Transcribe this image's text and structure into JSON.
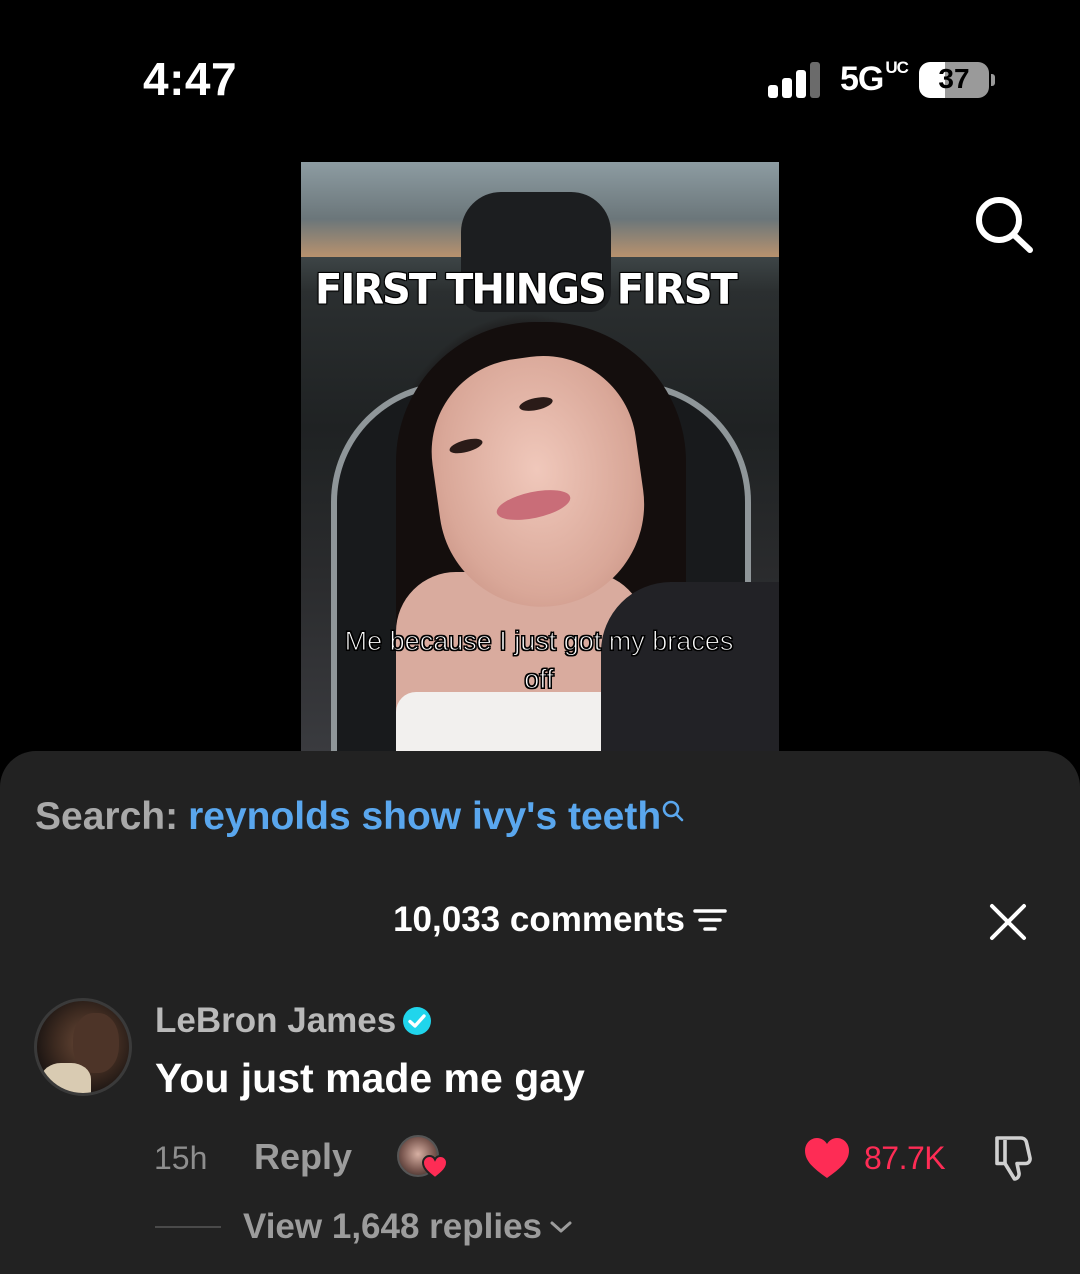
{
  "status_bar": {
    "time": "4:47",
    "network": "5G",
    "network_badge": "UC",
    "battery": "37"
  },
  "video": {
    "caption_top": "FIRST THINGS FIRST",
    "caption_bottom": "Me because I just got my braces off"
  },
  "search": {
    "label": "Search:",
    "term": "reynolds show ivy's teeth"
  },
  "comments": {
    "count_label": "10,033 comments",
    "items": [
      {
        "username": "LeBron James",
        "verified": true,
        "text": "You just made me gay",
        "time": "15h",
        "reply_label": "Reply",
        "likes": "87.7K",
        "view_replies": "View 1,648 replies"
      }
    ]
  },
  "colors": {
    "accent_red": "#fe2c55",
    "search_blue": "#5aa7ee",
    "verified_blue": "#20d5ec",
    "sheet_bg": "#222222"
  },
  "icons": [
    "search-icon",
    "filter-icon",
    "close-icon",
    "verified-icon",
    "heart-icon",
    "dislike-icon",
    "chevron-down-icon"
  ]
}
